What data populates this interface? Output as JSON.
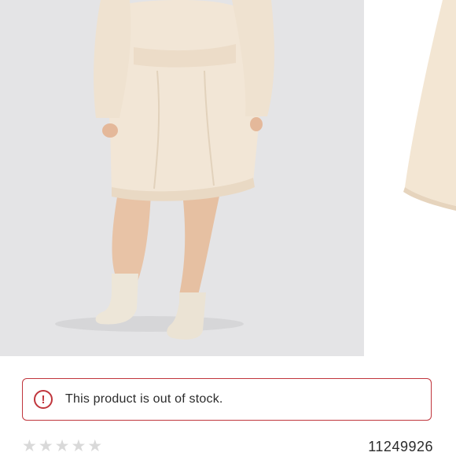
{
  "gallery": {
    "main_image_alt": "Cream fleece robe, back view with socks",
    "next_image_alt": "Cream robe sleeve detail"
  },
  "alert": {
    "icon": "alert-circle-icon",
    "message": "This product is out of stock.",
    "color": "#c0353c"
  },
  "rating": {
    "stars_total": 5,
    "stars_filled": 0,
    "star_glyph": "★",
    "empty_color": "#d9d9d9"
  },
  "product": {
    "id": "11249926"
  }
}
